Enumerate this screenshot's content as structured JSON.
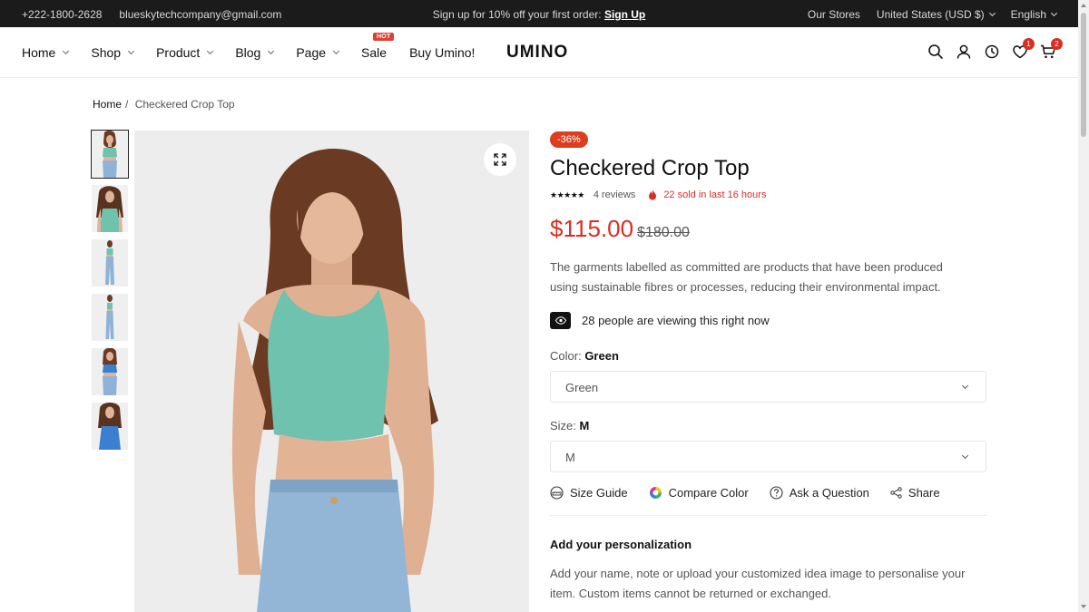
{
  "topbar": {
    "phone": "+222-1800-2628",
    "email": "blueskytechcompany@gmail.com",
    "promo_text": "Sign up for 10% off your first order:",
    "promo_link": "Sign Up",
    "our_stores": "Our Stores",
    "currency": "United States (USD $)",
    "language": "English"
  },
  "header": {
    "nav": [
      {
        "label": "Home"
      },
      {
        "label": "Shop"
      },
      {
        "label": "Product"
      },
      {
        "label": "Blog"
      },
      {
        "label": "Page"
      },
      {
        "label": "Sale",
        "badge": "HOT"
      },
      {
        "label": "Buy Umino!"
      }
    ],
    "logo": "UMINO",
    "wishlist_count": "1",
    "cart_count": "2"
  },
  "breadcrumb": {
    "home": "Home",
    "separator": "/",
    "current": "Checkered Crop Top"
  },
  "product": {
    "discount": "-36%",
    "title": "Checkered Crop Top",
    "stars": "★★★★★",
    "reviews": "4 reviews",
    "sold": "22 sold in last 16 hours",
    "price": "$115.00",
    "old_price": "$180.00",
    "description": "The garments labelled as committed are products that have been produced using sustainable fibres or processes, reducing their environmental impact.",
    "viewing": "28 people are viewing this right now",
    "color_label": "Color:",
    "color_value": "Green",
    "color_selected": "Green",
    "size_label": "Size:",
    "size_value": "M",
    "size_selected": "M",
    "actions": {
      "size_guide": "Size Guide",
      "compare_color": "Compare Color",
      "ask_question": "Ask a Question",
      "share": "Share"
    },
    "personalization_title": "Add your personalization",
    "personalization_desc": "Add your name, note or upload your customized idea image to personalise your item. Custom items cannot be returned or exchanged."
  },
  "colors": {
    "accent_red": "#db2e22",
    "discount_bg": "#dc3f1e",
    "topbar_bg": "#1b1b1b",
    "top_green": "#6fc2ad",
    "top_blue": "#3a7fd0"
  }
}
